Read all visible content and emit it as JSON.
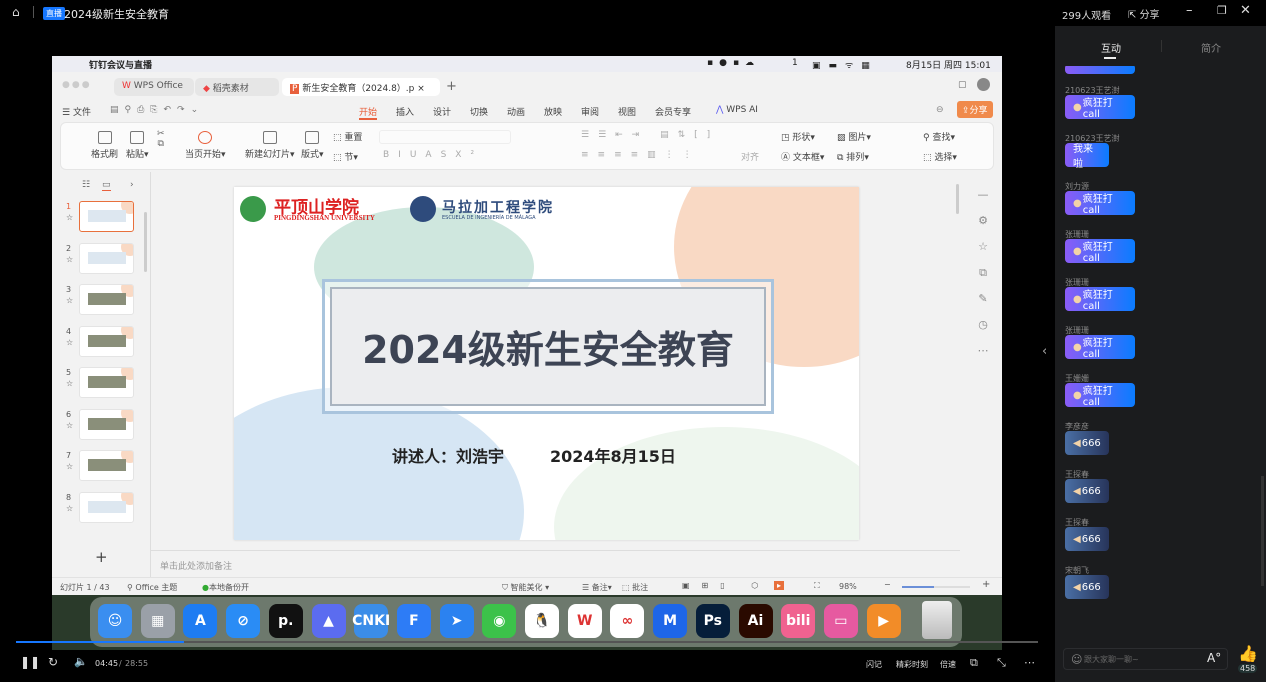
{
  "topbar": {
    "badge": "直播",
    "title": "2024级新生安全教育",
    "viewers": "299人观看",
    "share": "分享"
  },
  "mac": {
    "app": "钉钉会议与直播",
    "wechat_count": "1",
    "datetime": "8月15日 周四  15:01"
  },
  "wps": {
    "tabs": [
      "WPS Office",
      "稻壳素材",
      "新生安全教育（2024.8）.p"
    ],
    "file_menu": "文件",
    "menus": [
      "开始",
      "插入",
      "设计",
      "切换",
      "动画",
      "放映",
      "审阅",
      "视图",
      "会员专享"
    ],
    "ai": "WPS AI",
    "share": "分享",
    "ribbon": {
      "format_painter": "格式刷",
      "paste": "粘贴",
      "play_current": "当页开始",
      "new_slide": "新建幻灯片",
      "layout": "版式",
      "reset": "重置",
      "section": "节",
      "align": "对齐",
      "shape": "形状",
      "picture": "图片",
      "textbox": "文本框",
      "arrange": "排列",
      "find": "查找",
      "select": "选择"
    },
    "thumbnails": [
      "1",
      "2",
      "3",
      "4",
      "5",
      "6",
      "7",
      "8"
    ],
    "slide": {
      "school1": "平顶山学院",
      "school1_en": "PINGDINGSHAN UNIVERSITY",
      "school2": "马拉加工程学院",
      "school2_en": "ESCUELA DE INGENIERÍA DE MÁLAGA",
      "title": "2024级新生安全教育",
      "presenter": "讲述人：刘浩宇",
      "date": "2024年8月15日"
    },
    "notes_placeholder": "单击此处添加备注",
    "status": {
      "slide_count": "幻灯片 1 / 43",
      "theme": "Office 主题",
      "backup": "本地备份开",
      "beautify": "智能美化",
      "notes": "备注",
      "comment": "批注",
      "zoom": "98%"
    }
  },
  "dock": [
    {
      "n": "finder",
      "l": "☺",
      "c": "#3a8ef0"
    },
    {
      "n": "launchpad",
      "l": "▦",
      "c": "#9aa0a8"
    },
    {
      "n": "app-store",
      "l": "A",
      "c": "#1e7cf2"
    },
    {
      "n": "safari",
      "l": "⊘",
      "c": "#2a8cf5"
    },
    {
      "n": "pockity",
      "l": "p.",
      "c": "#111"
    },
    {
      "n": "preview",
      "l": "▲",
      "c": "#5b6cf0"
    },
    {
      "n": "cnki",
      "l": "CNKI",
      "c": "#3b8de8"
    },
    {
      "n": "feishu-doc",
      "l": "F",
      "c": "#2d7cf6"
    },
    {
      "n": "lark",
      "l": "➤",
      "c": "#2b82f0"
    },
    {
      "n": "wechat",
      "l": "◉",
      "c": "#3cc24a"
    },
    {
      "n": "qq",
      "l": "🐧",
      "c": "#fff"
    },
    {
      "n": "wps",
      "l": "W",
      "c": "#fff"
    },
    {
      "n": "baidu-netdisk",
      "l": "∞",
      "c": "#fff"
    },
    {
      "n": "mindmaster",
      "l": "M",
      "c": "#1e66e8"
    },
    {
      "n": "photoshop",
      "l": "Ps",
      "c": "#061e3a"
    },
    {
      "n": "illustrator",
      "l": "Ai",
      "c": "#2a0a00"
    },
    {
      "n": "bilibili",
      "l": "bili",
      "c": "#f06290"
    },
    {
      "n": "cleanmymac",
      "l": "▭",
      "c": "#e65aa0"
    },
    {
      "n": "video-player",
      "l": "▶",
      "c": "#f28c28"
    }
  ],
  "player": {
    "current": "04:45",
    "total": "28:55",
    "progress": 0.164,
    "flash": "闪记",
    "highlights": "精彩时刻",
    "speed": "倍速"
  },
  "panel": {
    "tab_interact": "互动",
    "tab_intro": "简介",
    "input_placeholder": "跟大家聊一聊~",
    "likes": "458",
    "messages": [
      {
        "name": "210623王艺澍",
        "text": "疯狂打call",
        "type": "call"
      },
      {
        "name": "210623王艺澍",
        "text": "我来啦",
        "type": "come"
      },
      {
        "name": "刘力源",
        "text": "疯狂打call",
        "type": "call"
      },
      {
        "name": "张珊珊",
        "text": "疯狂打call",
        "type": "call"
      },
      {
        "name": "张珊珊",
        "text": "疯狂打call",
        "type": "call"
      },
      {
        "name": "张珊珊",
        "text": "疯狂打call",
        "type": "call"
      },
      {
        "name": "王姗姗",
        "text": "疯狂打call",
        "type": "call"
      },
      {
        "name": "李彦彦",
        "text": "666",
        "type": "six"
      },
      {
        "name": "王探春",
        "text": "666",
        "type": "six"
      },
      {
        "name": "王探春",
        "text": "666",
        "type": "six"
      },
      {
        "name": "宋朝飞",
        "text": "666",
        "type": "six"
      }
    ]
  }
}
